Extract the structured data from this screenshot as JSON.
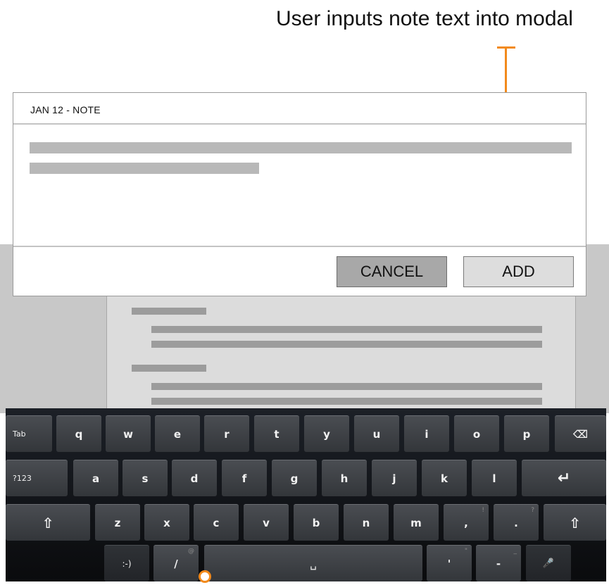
{
  "annotation": {
    "text": "User inputs note text into modal",
    "accent": "#f28a1c"
  },
  "modal": {
    "title": "JAN 12 - NOTE",
    "note_placeholder_lines": 2,
    "cancel_label": "CANCEL",
    "add_label": "ADD"
  },
  "keyboard": {
    "row1": [
      "Tab",
      "q",
      "w",
      "e",
      "r",
      "t",
      "y",
      "u",
      "i",
      "o",
      "p",
      "⌫"
    ],
    "row2": [
      "?123",
      "a",
      "s",
      "d",
      "f",
      "g",
      "h",
      "j",
      "k",
      "l",
      "↵"
    ],
    "row3": [
      "⇧",
      "z",
      "x",
      "c",
      "v",
      "b",
      "n",
      "m",
      ",",
      ".",
      "⇧"
    ],
    "row4": [
      ":-)",
      "/",
      "␣",
      "'",
      "-",
      "🎤"
    ],
    "hints": {
      "comma": "!",
      "period": "?",
      "slash": "@",
      "apostrophe": "\"",
      "dash": "_"
    },
    "icons": {
      "backspace": "backspace-icon",
      "enter": "enter-icon",
      "shift": "shift-icon",
      "mic": "microphone-icon"
    }
  }
}
